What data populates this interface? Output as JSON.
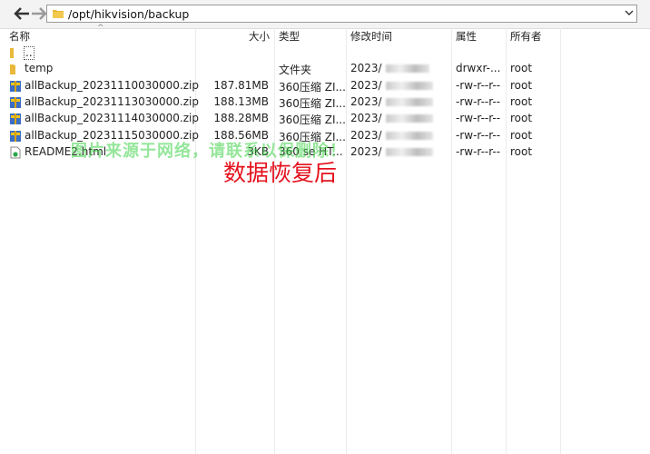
{
  "address_bar": {
    "path": "/opt/hikvision/backup"
  },
  "columns": {
    "name": "名称",
    "size": "大小",
    "type": "类型",
    "modified": "修改时间",
    "attributes": "属性",
    "owner": "所有者"
  },
  "files": [
    {
      "name": "..",
      "size": "",
      "type": "",
      "modified": "",
      "attributes": "",
      "owner": "",
      "icon": "parent-folder-icon"
    },
    {
      "name": "temp",
      "size": "",
      "type": "文件夹",
      "modified": "2023/",
      "attributes": "drwxr-...",
      "owner": "root",
      "icon": "folder-icon"
    },
    {
      "name": "allBackup_20231110030000.zip",
      "size": "187.81MB",
      "type": "360压缩 ZI...",
      "modified": "2023/",
      "attributes": "-rw-r--r--",
      "owner": "root",
      "icon": "zip-archive-icon"
    },
    {
      "name": "allBackup_20231113030000.zip",
      "size": "188.13MB",
      "type": "360压缩 ZI...",
      "modified": "2023/",
      "attributes": "-rw-r--r--",
      "owner": "root",
      "icon": "zip-archive-icon"
    },
    {
      "name": "allBackup_20231114030000.zip",
      "size": "188.28MB",
      "type": "360压缩 ZI...",
      "modified": "2023/",
      "attributes": "-rw-r--r--",
      "owner": "root",
      "icon": "zip-archive-icon"
    },
    {
      "name": "allBackup_20231115030000.zip",
      "size": "188.56MB",
      "type": "360压缩 ZI...",
      "modified": "2023/",
      "attributes": "-rw-r--r--",
      "owner": "root",
      "icon": "zip-archive-icon"
    },
    {
      "name": "README2.html",
      "size": "3KB",
      "type": "360 se HT...",
      "modified": "2023/",
      "attributes": "-rw-r--r--",
      "owner": "root",
      "icon": "html-file-icon"
    }
  ],
  "overlays": {
    "watermark": "图片来源于网络，请联系以保删除！",
    "caption": "数据恢复后"
  },
  "colors": {
    "folder": "#e8b93a",
    "caption": "#e4121e",
    "watermark": "#3cd246"
  }
}
